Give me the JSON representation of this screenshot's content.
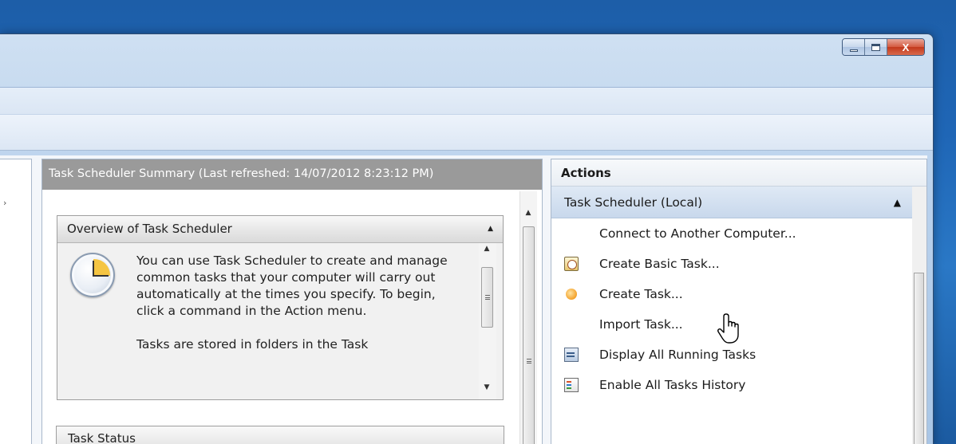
{
  "window": {
    "caption_buttons": {
      "minimize_icon": "minimize-icon",
      "maximize_icon": "maximize-icon",
      "close_label": "X"
    }
  },
  "center": {
    "header": "Task Scheduler Summary (Last refreshed: 14/07/2012 8:23:12 PM)",
    "overview": {
      "title": "Overview of Task Scheduler",
      "paragraph1": "You can use Task Scheduler to create and manage common tasks that your computer will carry out automatically at the times you specify. To begin, click a command in the Action menu.",
      "paragraph2": "Tasks are stored in folders in the Task"
    },
    "task_status": {
      "title": "Task Status"
    }
  },
  "actions": {
    "title": "Actions",
    "group": "Task Scheduler (Local)",
    "items": [
      {
        "label": "Connect to Another Computer...",
        "icon": "none"
      },
      {
        "label": "Create Basic Task...",
        "icon": "create-basic-task-icon"
      },
      {
        "label": "Create Task...",
        "icon": "create-task-icon"
      },
      {
        "label": "Import Task...",
        "icon": "none"
      },
      {
        "label": "Display All Running Tasks",
        "icon": "running-tasks-icon"
      },
      {
        "label": "Enable All Tasks History",
        "icon": "history-icon"
      }
    ]
  },
  "colors": {
    "desktop": "#1f66b6",
    "center_header_bg": "#9a9a9a",
    "actions_group_bg": "#c8d8ec",
    "close_button": "#c2381c"
  }
}
